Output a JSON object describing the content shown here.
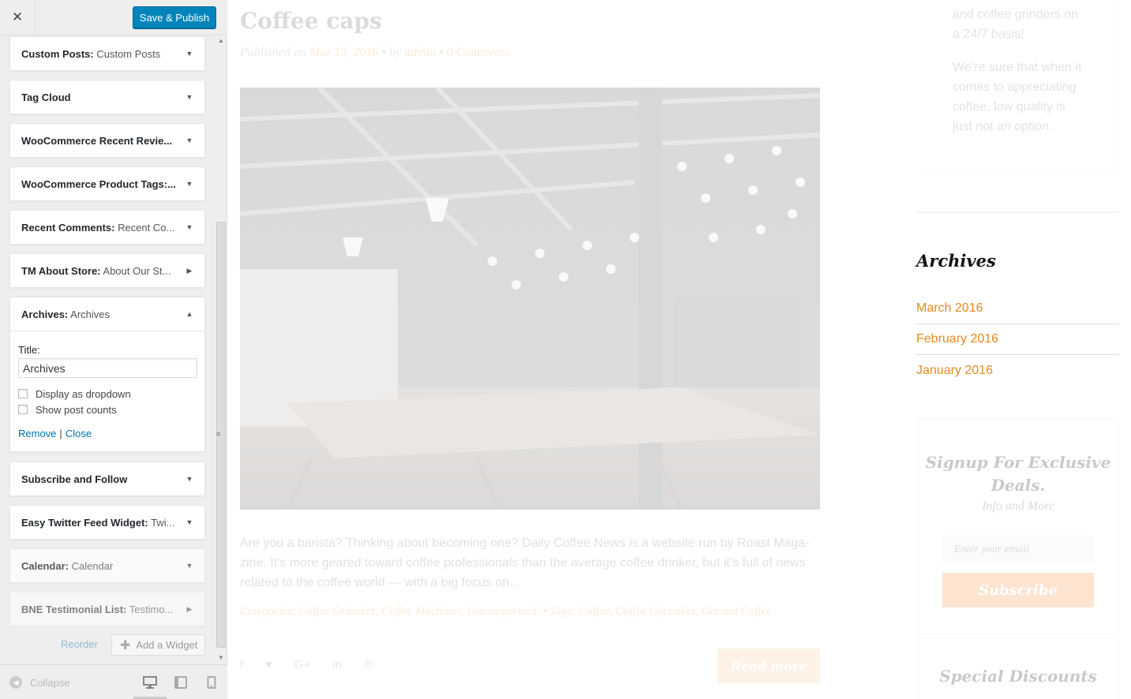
{
  "header": {
    "close_label": "✕",
    "publish_label": "Save & Publish"
  },
  "widgets": [
    {
      "name": "Custom Posts:",
      "title": " Custom Posts",
      "arrow": "▼"
    },
    {
      "name": "Tag Cloud",
      "title": "",
      "arrow": "▼"
    },
    {
      "name": "WooCommerce Recent Revie...",
      "title": "",
      "arrow": "▼"
    },
    {
      "name": "WooCommerce Product Tags:...",
      "title": "",
      "arrow": "▼"
    },
    {
      "name": "Recent Comments:",
      "title": " Recent Co...",
      "arrow": "▼"
    },
    {
      "name": "TM About Store:",
      "title": " About Our St...",
      "arrow": "▶"
    },
    {
      "name": "Archives:",
      "title": " Archives",
      "arrow": "▲"
    },
    {
      "name": "Subscribe and Follow",
      "title": "",
      "arrow": "▼"
    },
    {
      "name": "Easy Twitter Feed Widget:",
      "title": " Twi...",
      "arrow": "▼"
    },
    {
      "name": "Calendar:",
      "title": " Calendar",
      "arrow": "▼"
    },
    {
      "name": "BNE Testimonial List:",
      "title": " Testimo...",
      "arrow": "▶"
    }
  ],
  "archives_form": {
    "title_label": "Title:",
    "title_value": "Archives",
    "dropdown_label": "Display as dropdown",
    "dropdown_checked": false,
    "counts_label": "Show post counts",
    "counts_checked": false,
    "remove_label": "Remove",
    "separator": "|",
    "close_label": "Close"
  },
  "sidebar_actions": {
    "reorder_label": "Reorder",
    "add_widget_label": "Add a Widget"
  },
  "footer": {
    "collapse_label": "Collapse",
    "active_device": "desktop"
  },
  "preview": {
    "post": {
      "title": "Coffee caps",
      "meta_prefix": "Published on ",
      "date": "Mar 15, 2016",
      "by": " • by ",
      "author": "admin",
      "sep": " • ",
      "comments": "0 Comments",
      "excerpt": "Are you a barista? Thinking about becoming one? Daily Coffee News is a website run by Roast Maga-zine. It’s more geared toward coffee professionals than the average coffee drinker, but it’s full of news related to the coffee world — with a big focus on…",
      "categories_line": "Categories: Coffee Grinders, Coffee Machines, Uncategorized.  •  Tags: Coffee, Coffee Cupcakes, Ground Coffee",
      "read_more": "Read more",
      "social_icons": [
        "facebook-icon",
        "twitter-icon",
        "google-plus-icon",
        "linkedin-icon",
        "pinterest-icon"
      ]
    },
    "about_text_1": "and coffee grinders on a 24/7 basis!",
    "about_text_2": "We’re sure that when it comes to appreciating coffee, low quality is just not an option.",
    "archives": {
      "title": "Archives",
      "items": [
        "March 2016",
        "February 2016",
        "January 2016"
      ]
    },
    "signup": {
      "title": "Signup For Exclusive Deals.",
      "subtitle": "Info and More",
      "email_placeholder": "Enter your email",
      "button": "Subscribe"
    },
    "special": {
      "title": "Special Discounts"
    }
  },
  "colors": {
    "primary_button": "#0085ba",
    "accent": "#e58a1f",
    "link": "#0073aa"
  }
}
